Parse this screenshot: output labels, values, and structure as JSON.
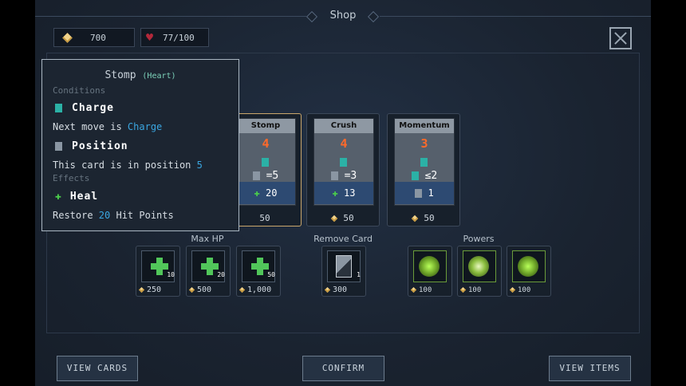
{
  "header": {
    "title": "Shop"
  },
  "stats": {
    "gems": "700",
    "hp": "77/100"
  },
  "cards": [
    {
      "name": "Stomp",
      "cost": "4",
      "condition": "=5",
      "effect": "20",
      "price": "50"
    },
    {
      "name": "Crush",
      "cost": "4",
      "condition": "=3",
      "effect": "13",
      "price": "50"
    },
    {
      "name": "Momentum",
      "cost": "3",
      "condition": "≤2",
      "effect": "1",
      "price": "50"
    }
  ],
  "groups": {
    "max_hp": "Max HP",
    "remove": "Remove Card",
    "powers": "Powers"
  },
  "max_hp_items": [
    {
      "amount": "10",
      "price": "250"
    },
    {
      "amount": "20",
      "price": "500"
    },
    {
      "amount": "50",
      "price": "1,000"
    }
  ],
  "remove_item": {
    "tag": "1",
    "price": "300"
  },
  "power_items": [
    {
      "price": "100"
    },
    {
      "price": "100"
    },
    {
      "price": "100"
    }
  ],
  "buttons": {
    "view_cards": "VIEW CARDS",
    "confirm": "CONFIRM",
    "view_items": "VIEW ITEMS"
  },
  "tooltip": {
    "title": "Stomp",
    "subtitle": "(Heart)",
    "conditions_label": "Conditions",
    "cond1_title": "Charge",
    "cond1_prefix": "Next move is ",
    "cond1_value": "Charge",
    "cond2_title": "Position",
    "cond2_prefix": "This card is in position ",
    "cond2_value": "5",
    "effects_label": "Effects",
    "effect_title": "Heal",
    "effect_prefix": "Restore ",
    "effect_value": "20",
    "effect_suffix": " Hit Points"
  },
  "colors": {
    "cost": "#ff6a2a",
    "highlight": "#3aa6e0",
    "heal": "#4bd04b"
  }
}
